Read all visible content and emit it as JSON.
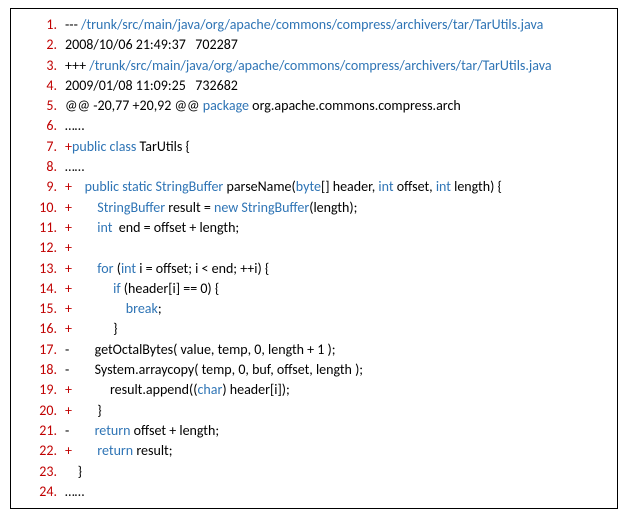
{
  "diff": {
    "lines": [
      {
        "n": "1.",
        "tokens": [
          [
            "plain",
            "--- "
          ],
          [
            "path",
            "/trunk/src/main/java/org/apache/commons/compress/archivers/tar/TarUtils.java"
          ]
        ]
      },
      {
        "n": "2.",
        "tokens": [
          [
            "plain",
            "2008/10/06 21:49:37   702287"
          ]
        ]
      },
      {
        "n": "3.",
        "tokens": [
          [
            "plain",
            "+++ "
          ],
          [
            "path",
            "/trunk/src/main/java/org/apache/commons/compress/archivers/tar/TarUtils.java"
          ]
        ]
      },
      {
        "n": "4.",
        "tokens": [
          [
            "plain",
            "2009/01/08 11:09:25   732682"
          ]
        ]
      },
      {
        "n": "5.",
        "tokens": [
          [
            "plain",
            "@@ -20,77 +20,92 @@ "
          ],
          [
            "kw",
            "package"
          ],
          [
            "plain",
            " org.apache.commons.compress.arch"
          ]
        ]
      },
      {
        "n": "6.",
        "tokens": [
          [
            "plain",
            "……"
          ]
        ]
      },
      {
        "n": "7.",
        "tokens": [
          [
            "red",
            "+"
          ],
          [
            "kw",
            "public class "
          ],
          [
            "plain",
            "TarUtils {"
          ]
        ]
      },
      {
        "n": "8.",
        "tokens": [
          [
            "plain",
            "……"
          ]
        ]
      },
      {
        "n": "9.",
        "tokens": [
          [
            "red",
            "+    "
          ],
          [
            "kw",
            "public static StringBuffer "
          ],
          [
            "plain",
            "parseName("
          ],
          [
            "kw",
            "byte"
          ],
          [
            "plain",
            "[] header, "
          ],
          [
            "kw",
            "int"
          ],
          [
            "plain",
            " offset, "
          ],
          [
            "kw",
            "int"
          ],
          [
            "plain",
            " length) {"
          ]
        ]
      },
      {
        "n": "10.",
        "tokens": [
          [
            "red",
            "+        "
          ],
          [
            "kw",
            "StringBuffer "
          ],
          [
            "plain",
            "result = "
          ],
          [
            "kw",
            "new StringBuffer"
          ],
          [
            "plain",
            "(length);"
          ]
        ]
      },
      {
        "n": "11.",
        "tokens": [
          [
            "red",
            "+        "
          ],
          [
            "kw",
            "int"
          ],
          [
            "plain",
            "  end = offset + length;"
          ]
        ]
      },
      {
        "n": "12.",
        "tokens": [
          [
            "red",
            "+"
          ]
        ]
      },
      {
        "n": "13.",
        "tokens": [
          [
            "red",
            "+        "
          ],
          [
            "kw",
            "for "
          ],
          [
            "plain",
            "("
          ],
          [
            "kw",
            "int "
          ],
          [
            "plain",
            "i = offset; i < end; ++i) {"
          ]
        ]
      },
      {
        "n": "14.",
        "tokens": [
          [
            "red",
            "+             "
          ],
          [
            "kw",
            "if "
          ],
          [
            "plain",
            "(header[i] == 0) {"
          ]
        ]
      },
      {
        "n": "15.",
        "tokens": [
          [
            "red",
            "+                 "
          ],
          [
            "kw",
            "break"
          ],
          [
            "plain",
            ";"
          ]
        ]
      },
      {
        "n": "16.",
        "tokens": [
          [
            "red",
            "+             "
          ],
          [
            "plain",
            "}"
          ]
        ]
      },
      {
        "n": "17.",
        "tokens": [
          [
            "plain",
            "-        getOctalBytes( value, temp, 0, length + 1 );"
          ]
        ]
      },
      {
        "n": "18.",
        "tokens": [
          [
            "plain",
            "-        System.arraycopy( temp, 0, buf, offset, length );"
          ]
        ]
      },
      {
        "n": "19.",
        "tokens": [
          [
            "red",
            "+            "
          ],
          [
            "plain",
            "result.append(("
          ],
          [
            "kw",
            "char"
          ],
          [
            "plain",
            ") header[i]);"
          ]
        ]
      },
      {
        "n": "20.",
        "tokens": [
          [
            "red",
            "+        "
          ],
          [
            "plain",
            "}"
          ]
        ]
      },
      {
        "n": "21.",
        "tokens": [
          [
            "plain",
            "-        "
          ],
          [
            "kw",
            "return "
          ],
          [
            "plain",
            "offset + length;"
          ]
        ]
      },
      {
        "n": "22.",
        "tokens": [
          [
            "red",
            "+        "
          ],
          [
            "kw",
            "return "
          ],
          [
            "plain",
            "result;"
          ]
        ]
      },
      {
        "n": "23.",
        "tokens": [
          [
            "plain",
            "    }"
          ]
        ]
      },
      {
        "n": "24.",
        "tokens": [
          [
            "plain",
            "……"
          ]
        ]
      }
    ]
  }
}
